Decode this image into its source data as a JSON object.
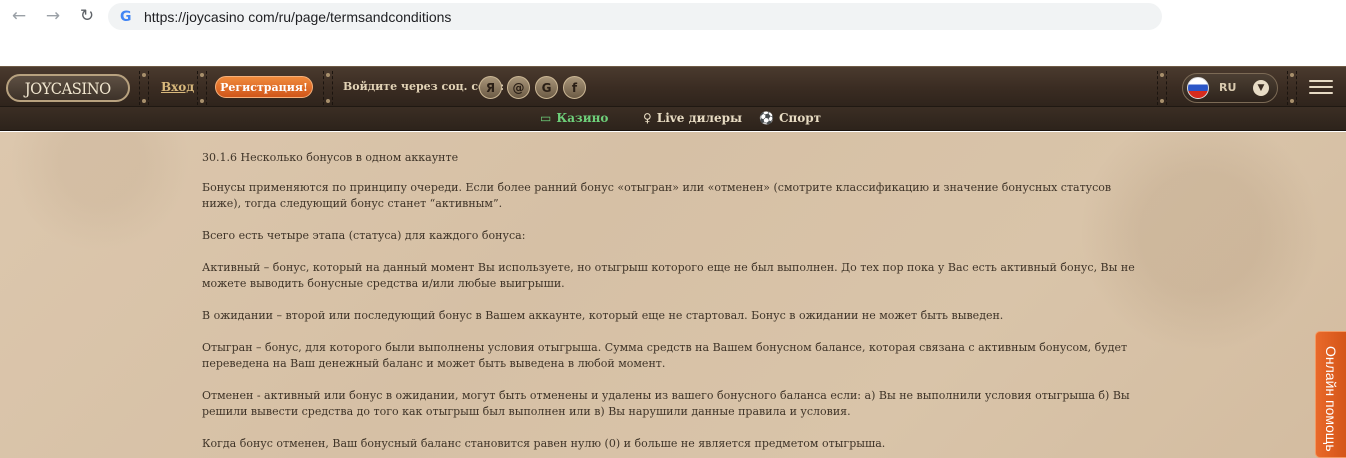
{
  "browser": {
    "url": "https://joycasino com/ru/page/termsandconditions",
    "back_icon": "←",
    "forward_icon": "→",
    "reload_icon": "↻",
    "google_icon": "G"
  },
  "header": {
    "logo": "JOYCASINO",
    "login": "Вход",
    "register": "Регистрация!",
    "social_label": "Войдите через соц. сети:",
    "social": [
      {
        "name": "yandex-icon",
        "glyph": "Я"
      },
      {
        "name": "mail-icon",
        "glyph": "@"
      },
      {
        "name": "google-icon",
        "glyph": "G"
      },
      {
        "name": "facebook-icon",
        "glyph": "f"
      }
    ],
    "language": "RU",
    "lang_chevron": "▼"
  },
  "subnav": {
    "casino": "Казино",
    "live": "Live дилеры",
    "sport": "Спорт",
    "casino_icon": "▭",
    "live_icon": "♀",
    "sport_icon": "⚽",
    "active_color": "#6ed07a"
  },
  "content": {
    "heading": "30.1.6 Несколько бонусов в одном аккаунте",
    "p1": "Бонусы применяются по принципу очереди. Если более ранний бонус «отыгран» или «отменен» (смотрите классификацию и значение бонусных статусов ниже), тогда следующий бонус станет “активным”.",
    "p2": "Всего есть четыре этапа (статуса) для каждого бонуса:",
    "p3": "Активный – бонус, который на данный момент Вы используете, но отыгрыш которого еще не был выполнен. До тех пор пока у Вас есть активный бонус, Вы не можете выводить бонусные средства и/или любые выигрыши.",
    "p4": "В ожидании – второй или последующий бонус в Вашем аккаунте, который еще не стартовал. Бонус в ожидании не может быть выведен.",
    "p5": "Отыгран – бонус, для которого были выполнены условия отыгрыша. Сумма средств на Вашем бонусном балансе, которая связана с активным бонусом, будет переведена на Ваш денежный баланс и может быть выведена в любой момент.",
    "p6": "Отменен - активный или бонус в ожидании, могут быть отменены и удалены из вашего бонусного баланса если: а) Вы не выполнили условия отыгрыша б) Вы решили вывести средства до того как отыгрыш был выполнен или в) Вы нарушили данные правила и условия.",
    "p7": "Когда бонус отменен, Ваш бонусный баланс становится равен нулю (0) и больше не является предметом отыгрыша."
  },
  "help_tab": "Онлайн помощь",
  "colors": {
    "brand_orange": "#e9692a",
    "header_brown": "#3a2c22",
    "parchment": "#d9c4a9"
  }
}
